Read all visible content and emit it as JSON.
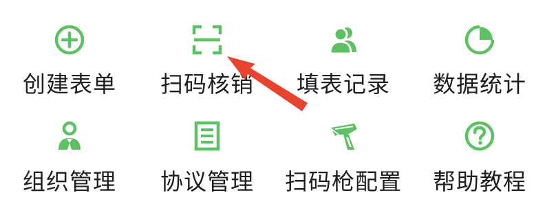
{
  "colors": {
    "icon_green": "#5cc163",
    "label_text": "#1f1f1f",
    "annotation_arrow": "#e8432f",
    "background": "#ffffff"
  },
  "menu": {
    "items": [
      {
        "label": "创建表单",
        "icon": "plus-circle-icon"
      },
      {
        "label": "扫码核销",
        "icon": "scan-frame-icon"
      },
      {
        "label": "填表记录",
        "icon": "users-icon"
      },
      {
        "label": "数据统计",
        "icon": "pie-chart-icon"
      },
      {
        "label": "组织管理",
        "icon": "org-person-icon"
      },
      {
        "label": "协议管理",
        "icon": "document-list-icon"
      },
      {
        "label": "扫码枪配置",
        "icon": "scanner-gun-icon"
      },
      {
        "label": "帮助教程",
        "icon": "help-circle-icon"
      }
    ]
  }
}
